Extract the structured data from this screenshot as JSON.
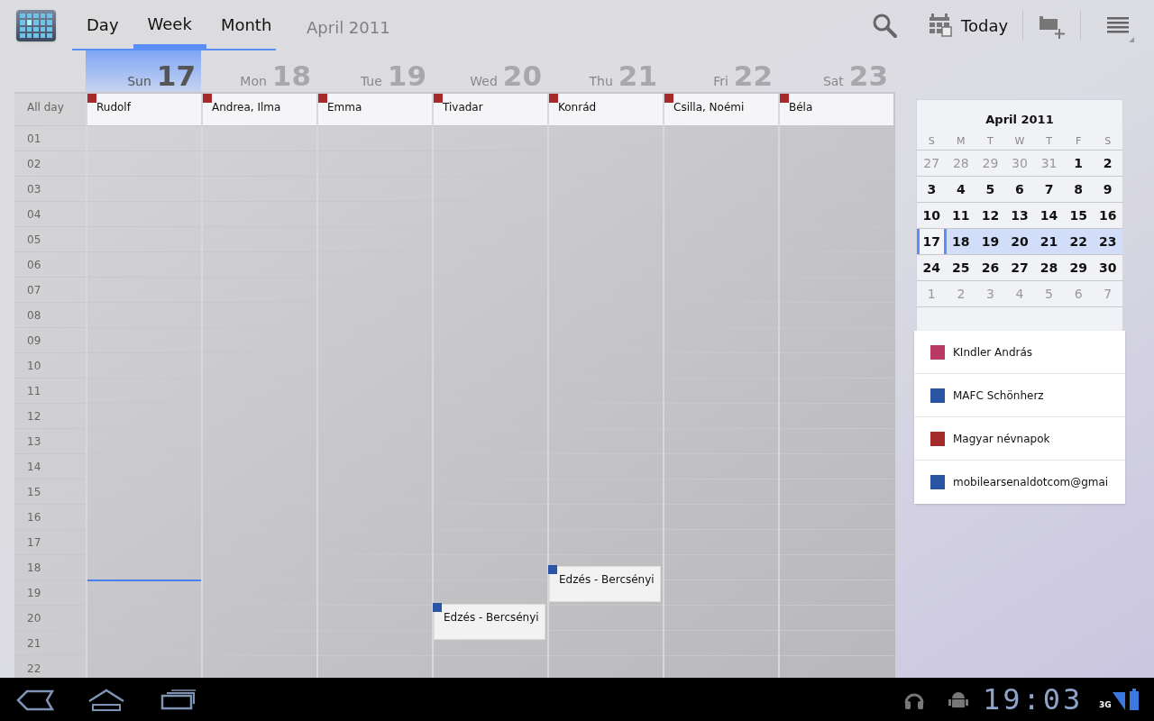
{
  "action_bar": {
    "tabs": [
      {
        "label": "Day",
        "selected": false
      },
      {
        "label": "Week",
        "selected": true
      },
      {
        "label": "Month",
        "selected": false
      }
    ],
    "title": "April 2011",
    "today_button": "Today"
  },
  "week": {
    "all_day_label": "All day",
    "hours": [
      "01",
      "02",
      "03",
      "04",
      "05",
      "06",
      "07",
      "08",
      "09",
      "10",
      "11",
      "12",
      "13",
      "14",
      "15",
      "16",
      "17",
      "18",
      "19",
      "20",
      "21",
      "22"
    ],
    "days": [
      {
        "name": "Sun",
        "number": "17",
        "today": true,
        "all_day": {
          "title": "Rudolf",
          "color": "#a52a2a"
        }
      },
      {
        "name": "Mon",
        "number": "18",
        "today": false,
        "all_day": {
          "title": "Andrea, Ilma",
          "color": "#a52a2a"
        }
      },
      {
        "name": "Tue",
        "number": "19",
        "today": false,
        "all_day": {
          "title": "Emma",
          "color": "#a52a2a"
        }
      },
      {
        "name": "Wed",
        "number": "20",
        "today": false,
        "all_day": {
          "title": "Tivadar",
          "color": "#a52a2a"
        },
        "events": [
          {
            "title": "Edzés - Bercsényi",
            "color": "#2a55a5"
          }
        ]
      },
      {
        "name": "Thu",
        "number": "21",
        "today": false,
        "all_day": {
          "title": "Konrád",
          "color": "#a52a2a"
        },
        "events": [
          {
            "title": "Edzés - Bercsényi",
            "color": "#2a55a5"
          }
        ]
      },
      {
        "name": "Fri",
        "number": "22",
        "today": false,
        "all_day": {
          "title": "Csilla, Noémi",
          "color": "#a52a2a"
        }
      },
      {
        "name": "Sat",
        "number": "23",
        "today": false,
        "all_day": {
          "title": "Béla",
          "color": "#a52a2a"
        }
      }
    ]
  },
  "mini_calendar": {
    "title": "April 2011",
    "weekdays": [
      "S",
      "M",
      "T",
      "W",
      "T",
      "F",
      "S"
    ],
    "weeks": [
      {
        "selected": false,
        "days": [
          {
            "label": "27",
            "muted": true,
            "today": false
          },
          {
            "label": "28",
            "muted": true,
            "today": false
          },
          {
            "label": "29",
            "muted": true,
            "today": false
          },
          {
            "label": "30",
            "muted": true,
            "today": false
          },
          {
            "label": "31",
            "muted": true,
            "today": false
          },
          {
            "label": "1",
            "muted": false,
            "today": false
          },
          {
            "label": "2",
            "muted": false,
            "today": false
          }
        ]
      },
      {
        "selected": false,
        "days": [
          {
            "label": "3",
            "muted": false,
            "today": false
          },
          {
            "label": "4",
            "muted": false,
            "today": false
          },
          {
            "label": "5",
            "muted": false,
            "today": false
          },
          {
            "label": "6",
            "muted": false,
            "today": false
          },
          {
            "label": "7",
            "muted": false,
            "today": false
          },
          {
            "label": "8",
            "muted": false,
            "today": false
          },
          {
            "label": "9",
            "muted": false,
            "today": false
          }
        ]
      },
      {
        "selected": false,
        "days": [
          {
            "label": "10",
            "muted": false,
            "today": false
          },
          {
            "label": "11",
            "muted": false,
            "today": false
          },
          {
            "label": "12",
            "muted": false,
            "today": false
          },
          {
            "label": "13",
            "muted": false,
            "today": false
          },
          {
            "label": "14",
            "muted": false,
            "today": false
          },
          {
            "label": "15",
            "muted": false,
            "today": false
          },
          {
            "label": "16",
            "muted": false,
            "today": false
          }
        ]
      },
      {
        "selected": true,
        "days": [
          {
            "label": "17",
            "muted": false,
            "today": true
          },
          {
            "label": "18",
            "muted": false,
            "today": false
          },
          {
            "label": "19",
            "muted": false,
            "today": false
          },
          {
            "label": "20",
            "muted": false,
            "today": false
          },
          {
            "label": "21",
            "muted": false,
            "today": false
          },
          {
            "label": "22",
            "muted": false,
            "today": false
          },
          {
            "label": "23",
            "muted": false,
            "today": false
          }
        ]
      },
      {
        "selected": false,
        "days": [
          {
            "label": "24",
            "muted": false,
            "today": false
          },
          {
            "label": "25",
            "muted": false,
            "today": false
          },
          {
            "label": "26",
            "muted": false,
            "today": false
          },
          {
            "label": "27",
            "muted": false,
            "today": false
          },
          {
            "label": "28",
            "muted": false,
            "today": false
          },
          {
            "label": "29",
            "muted": false,
            "today": false
          },
          {
            "label": "30",
            "muted": false,
            "today": false
          }
        ]
      },
      {
        "selected": false,
        "days": [
          {
            "label": "1",
            "muted": true,
            "today": false
          },
          {
            "label": "2",
            "muted": true,
            "today": false
          },
          {
            "label": "3",
            "muted": true,
            "today": false
          },
          {
            "label": "4",
            "muted": true,
            "today": false
          },
          {
            "label": "5",
            "muted": true,
            "today": false
          },
          {
            "label": "6",
            "muted": true,
            "today": false
          },
          {
            "label": "7",
            "muted": true,
            "today": false
          }
        ]
      }
    ]
  },
  "calendars": [
    {
      "name": "KIndler András",
      "color": "#b83a62"
    },
    {
      "name": "MAFC Schönherz",
      "color": "#2a55a5"
    },
    {
      "name": "Magyar névnapok",
      "color": "#a52a2a"
    },
    {
      "name": "mobilearsenaldotcom@gmai",
      "color": "#2a55a5"
    }
  ],
  "status_bar": {
    "clock": "19:03",
    "network": "3G"
  }
}
